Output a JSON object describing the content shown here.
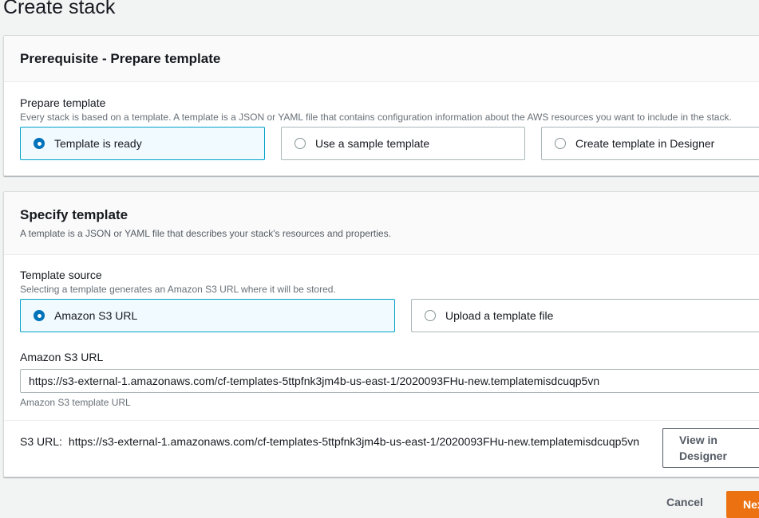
{
  "page": {
    "title": "Create stack"
  },
  "prerequisite": {
    "title": "Prerequisite - Prepare template",
    "field_label": "Prepare template",
    "field_desc": "Every stack is based on a template. A template is a JSON or YAML file that contains configuration information about the AWS resources you want to include in the stack.",
    "options": [
      {
        "label": "Template is ready",
        "selected": true
      },
      {
        "label": "Use a sample template",
        "selected": false
      },
      {
        "label": "Create template in Designer",
        "selected": false
      }
    ]
  },
  "specify": {
    "title": "Specify template",
    "desc": "A template is a JSON or YAML file that describes your stack's resources and properties.",
    "source_label": "Template source",
    "source_desc": "Selecting a template generates an Amazon S3 URL where it will be stored.",
    "source_options": [
      {
        "label": "Amazon S3 URL",
        "selected": true
      },
      {
        "label": "Upload a template file",
        "selected": false
      }
    ],
    "url_label": "Amazon S3 URL",
    "url_value": "https://s3-external-1.amazonaws.com/cf-templates-5ttpfnk3jm4b-us-east-1/2020093FHu-new.templatemisdcuqp5vn",
    "url_hint": "Amazon S3 template URL",
    "s3url_key": "S3 URL:",
    "s3url_value": "https://s3-external-1.amazonaws.com/cf-templates-5ttpfnk3jm4b-us-east-1/2020093FHu-new.templatemisdcuqp5vn",
    "view_designer_label": "View in Designer"
  },
  "footer": {
    "cancel_label": "Cancel",
    "next_label": "Next"
  },
  "colors": {
    "accent": "#0073bb",
    "selected_border": "#00a1c9",
    "primary_button": "#ec7211"
  }
}
